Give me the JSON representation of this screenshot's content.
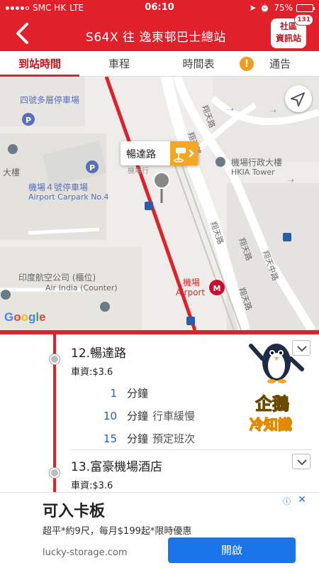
{
  "status_bar": {
    "carrier": "SMC HK",
    "network": "LTE",
    "time": "06:10",
    "battery": "75%",
    "battery_level": 0.75
  },
  "header": {
    "title": "S64X 往 逸東邨巴士總站",
    "community_label_line1": "社區",
    "community_label_line2": "資訊站",
    "community_badge": "131"
  },
  "tabs": [
    {
      "label": "到站時間",
      "active": true
    },
    {
      "label": "車程",
      "active": false
    },
    {
      "label": "時間表",
      "active": false
    },
    {
      "label": "通告",
      "active": false
    }
  ],
  "map": {
    "callout_label": "暢達路",
    "labels": {
      "carpark_multistorey": "四號多層停車場",
      "carpark4_zh": "機場４號停車場",
      "carpark4_en": "Airport Carpark No.4",
      "building_left": "大樓",
      "admin_building_zh": "機場行政大樓",
      "admin_building_en": "HKIA Tower",
      "air_india_zh": "印度航空公司 (櫃位)",
      "air_india_en": "Air India (Counter)",
      "airport_zh": "機場",
      "airport_en": "Airport",
      "road_1": "翔天路",
      "road_2": "翔天路",
      "road_3": "翔天路",
      "road_4": "翔天路",
      "road_5": "翔天路",
      "road_6": "翔天中路",
      "obscured": "機場行"
    },
    "google_logo": "Google",
    "colors": {
      "route": "#e0202a",
      "google": [
        "#4285F4",
        "#EA4335",
        "#FBBC05",
        "#4285F4",
        "#34A853",
        "#EA4335"
      ]
    }
  },
  "stops": [
    {
      "name": "12.暢達路",
      "fare": "車資:$3.6",
      "etas": [
        {
          "minutes": "1",
          "unit": "分鐘",
          "note": ""
        },
        {
          "minutes": "10",
          "unit": "分鐘",
          "note": "行車緩慢"
        },
        {
          "minutes": "15",
          "unit": "分鐘",
          "note": "預定班次"
        }
      ]
    },
    {
      "name": "13.富豪機場酒店",
      "fare": "車資:$3.6",
      "etas": []
    }
  ],
  "mascot": {
    "line1": "企鵝",
    "line2": "冷知識"
  },
  "ad": {
    "headline": "可入卡板",
    "subtext": "超平*約9尺，每月$199起*限時優惠",
    "url": "lucky-storage.com",
    "cta": "開啟",
    "close": "✕"
  }
}
